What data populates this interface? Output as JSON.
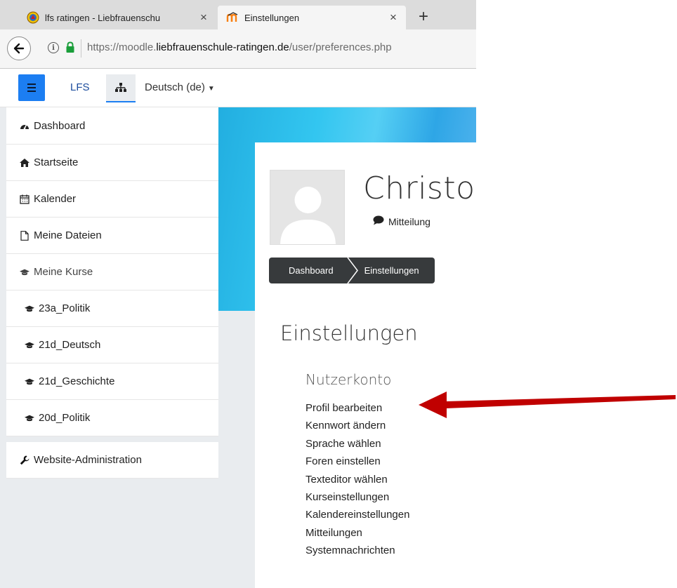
{
  "browser": {
    "tabs": [
      {
        "label": "lfs ratingen - Liebfrauenschu",
        "active": false,
        "icon": "school-crest-icon"
      },
      {
        "label": "Einstellungen",
        "active": true,
        "icon": "moodle-icon"
      }
    ],
    "new_tab_label": "+",
    "close_glyph": "×",
    "url": {
      "prefix": "https://moodle.",
      "host": "liebfrauenschule-ratingen.de",
      "path": "/user/preferences.php"
    }
  },
  "navbar": {
    "brand": "LFS",
    "language": "Deutsch (de)",
    "accent_color": "#1c7ef2"
  },
  "drawer": {
    "items": [
      {
        "label": "Dashboard",
        "icon": "dashboard-icon"
      },
      {
        "label": "Startseite",
        "icon": "home-icon"
      },
      {
        "label": "Kalender",
        "icon": "calendar-icon"
      },
      {
        "label": "Meine Dateien",
        "icon": "file-icon"
      },
      {
        "label": "Meine Kurse",
        "icon": "graduation-cap-icon"
      }
    ],
    "courses": [
      {
        "label": "23a_Politik",
        "icon": "graduation-cap-icon"
      },
      {
        "label": "21d_Deutsch",
        "icon": "graduation-cap-icon"
      },
      {
        "label": "21d_Geschichte",
        "icon": "graduation-cap-icon"
      },
      {
        "label": "20d_Politik",
        "icon": "graduation-cap-icon"
      }
    ],
    "admin": {
      "label": "Website-Administration",
      "icon": "wrench-icon"
    }
  },
  "header": {
    "fullname": "Christoph",
    "message_label": "Mitteilung",
    "breadcrumb": [
      "Dashboard",
      "Einstellungen"
    ]
  },
  "main": {
    "heading": "Einstellungen",
    "section": {
      "title": "Nutzerkonto",
      "links": [
        "Profil bearbeiten",
        "Kennwort ändern",
        "Sprache wählen",
        "Foren einstellen",
        "Texteditor wählen",
        "Kurseinstellungen",
        "Kalendereinstellungen",
        "Mitteilungen",
        "Systemnachrichten"
      ]
    }
  },
  "annotation": {
    "arrow_color": "#c00000",
    "points_to": "Profil bearbeiten"
  }
}
